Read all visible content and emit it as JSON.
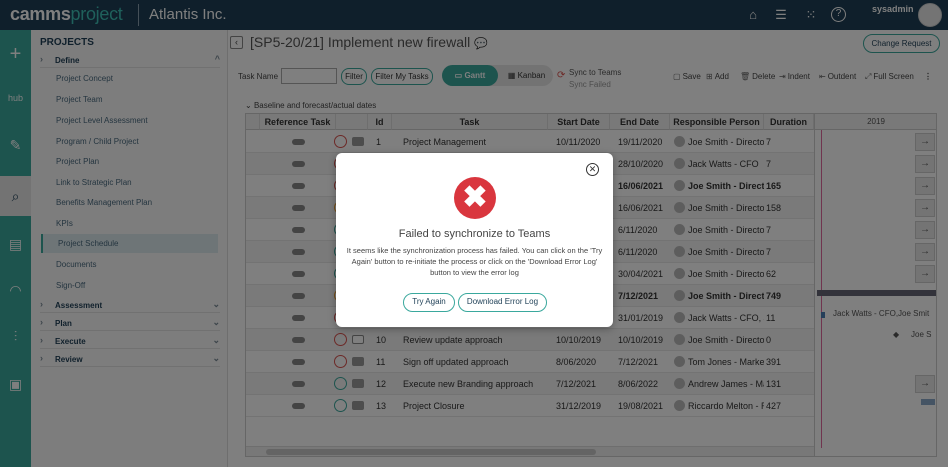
{
  "topbar": {
    "logo_main": "camms",
    "logo_accent": "project",
    "org_name": "Atlantis Inc.",
    "icons": [
      "home-icon",
      "menu-icon",
      "apps-grid-icon",
      "help-icon"
    ],
    "username": "sysadmin"
  },
  "rail": {
    "items": [
      {
        "icon": "plus-icon",
        "label": "+"
      },
      {
        "icon": "hub-icon",
        "label": "hub"
      },
      {
        "icon": "edit-icon",
        "label": "✎"
      },
      {
        "icon": "search-doc-icon",
        "label": "⌕"
      },
      {
        "icon": "schedule-icon",
        "label": "▤"
      },
      {
        "icon": "gauge-icon",
        "label": "◠"
      },
      {
        "icon": "sliders-icon",
        "label": "⫶"
      },
      {
        "icon": "report-icon",
        "label": "▣"
      }
    ]
  },
  "sidebar": {
    "heading": "PROJECTS",
    "define_label": "Define",
    "items": [
      "Project Concept",
      "Project Team",
      "Project Level Assessment",
      "Program / Child Project",
      "Project Plan",
      "Link to Strategic Plan",
      "Benefits Management Plan",
      "KPIs",
      "Project Schedule",
      "Documents",
      "Sign-Off"
    ],
    "sections": [
      "Assessment",
      "Plan",
      "Execute",
      "Review"
    ]
  },
  "header": {
    "title": "[SP5-20/21] Implement new firewall",
    "change_request": "Change Request"
  },
  "toolbar": {
    "task_name_label": "Task Name",
    "task_name_value": "",
    "filter": "Filter",
    "filter_my_tasks": "Filter My Tasks",
    "gantt": "Gantt",
    "kanban": "Kanban",
    "sync_title": "Sync to Teams",
    "sync_status": "Sync Failed",
    "save": "Save",
    "add": "Add",
    "delete": "Delete",
    "indent": "Indent",
    "outdent": "Outdent",
    "full_screen": "Full Screen"
  },
  "grid": {
    "section_label": "Baseline and forecast/actual dates",
    "columns": [
      "Reference Task",
      "Id",
      "Task",
      "Start Date",
      "End Date",
      "Responsible Person",
      "Duration"
    ],
    "year": "2019",
    "rows": [
      {
        "status": "red",
        "chat": "filled",
        "id": "1",
        "task": "Project Management",
        "start": "10/11/2020",
        "end": "19/11/2020",
        "person": "Joe Smith - Director",
        "duration": "7",
        "bold": false
      },
      {
        "status": "red",
        "chat": "filled",
        "id": "",
        "task": "",
        "start": "",
        "end": "28/10/2020",
        "person": "Jack Watts - CFO",
        "duration": "7",
        "bold": false
      },
      {
        "status": "red",
        "chat": "filled",
        "id": "",
        "task": "",
        "start": "",
        "end": "16/06/2021",
        "person": "Joe Smith - Director",
        "duration": "165",
        "bold": true
      },
      {
        "status": "orange",
        "chat": "filled",
        "id": "",
        "task": "",
        "start": "",
        "end": "16/06/2021",
        "person": "Joe Smith - Director",
        "duration": "158",
        "bold": false
      },
      {
        "status": "green",
        "chat": "filled",
        "id": "",
        "task": "",
        "start": "",
        "end": "6/11/2020",
        "person": "Joe Smith - Director",
        "duration": "7",
        "bold": false
      },
      {
        "status": "green",
        "chat": "filled",
        "id": "",
        "task": "",
        "start": "",
        "end": "6/11/2020",
        "person": "Joe Smith - Director",
        "duration": "7",
        "bold": false
      },
      {
        "status": "green",
        "chat": "filled",
        "id": "",
        "task": "",
        "start": "",
        "end": "30/04/2021",
        "person": "Joe Smith - Director",
        "duration": "62",
        "bold": false
      },
      {
        "status": "orange",
        "chat": "filled",
        "id": "",
        "task": "",
        "start": "",
        "end": "7/12/2021",
        "person": "Joe Smith - Director",
        "duration": "749",
        "bold": true
      },
      {
        "status": "red",
        "chat": "filled",
        "id": "",
        "task": "",
        "start": "",
        "end": "31/01/2019",
        "person": "Jack Watts - CFO, Jo",
        "duration": "11",
        "bold": false
      },
      {
        "status": "red",
        "chat": "outline",
        "id": "10",
        "task": "Review update approach",
        "start": "10/10/2019",
        "end": "10/10/2019",
        "person": "Joe Smith - Director",
        "duration": "0",
        "bold": false
      },
      {
        "status": "red",
        "chat": "filled",
        "id": "11",
        "task": "Sign off updated approach",
        "start": "8/06/2020",
        "end": "7/12/2021",
        "person": "Tom Jones - Market",
        "duration": "391",
        "bold": false
      },
      {
        "status": "green",
        "chat": "filled",
        "id": "12",
        "task": "Execute new Branding approach",
        "start": "7/12/2021",
        "end": "8/06/2022",
        "person": "Andrew James - Ma",
        "duration": "131",
        "bold": false
      },
      {
        "status": "green",
        "chat": "filled",
        "id": "13",
        "task": "Project Closure",
        "start": "31/12/2019",
        "end": "19/08/2021",
        "person": "Riccardo Melton - R",
        "duration": "427",
        "bold": false
      }
    ],
    "gantt_labels": [
      "Jack Watts - CFO,Joe Smit",
      "Joe S"
    ]
  },
  "modal": {
    "title": "Failed to synchronize to Teams",
    "body": "It seems like the synchronization process has failed. You can click on the 'Try Again' button to re-initiate the process or click on the 'Download Error Log' button to view the error log",
    "try_again": "Try Again",
    "download_log": "Download Error Log"
  },
  "colors": {
    "topbar": "#1e3f56",
    "accent": "#3aa89d",
    "error": "#d9363e"
  }
}
